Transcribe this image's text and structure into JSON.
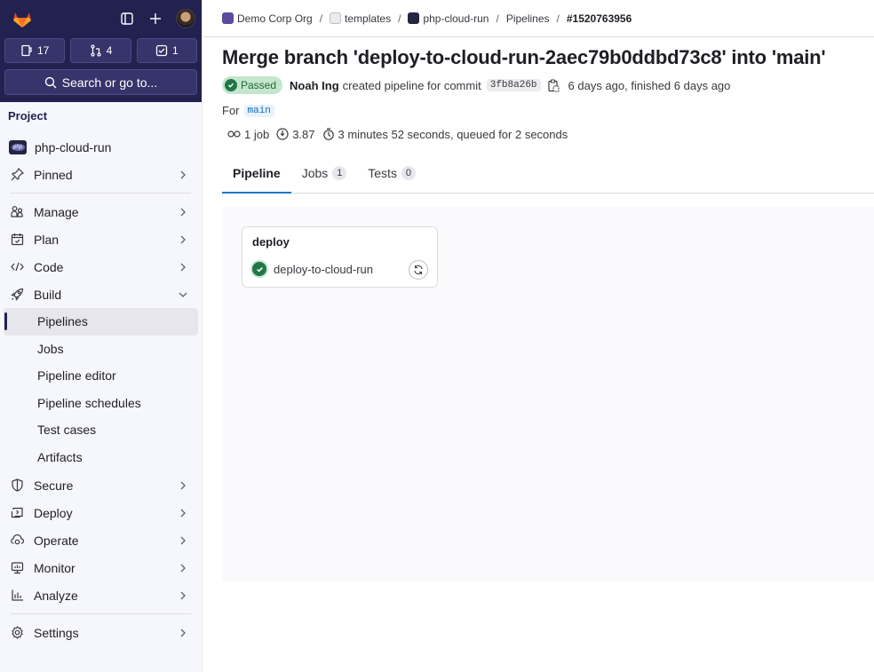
{
  "sidebar": {
    "counts": [
      {
        "icon": "issues-icon",
        "value": "17"
      },
      {
        "icon": "merge-request-icon",
        "value": "4"
      },
      {
        "icon": "todo-icon",
        "value": "1"
      }
    ],
    "search_label": "Search or go to...",
    "section_heading": "Project",
    "project_name": "php-cloud-run",
    "project_avatar_text": "php",
    "pinned_label": "Pinned",
    "items": [
      {
        "label": "Manage",
        "icon": "users-icon"
      },
      {
        "label": "Plan",
        "icon": "calendar-icon"
      },
      {
        "label": "Code",
        "icon": "code-icon"
      },
      {
        "label": "Build",
        "icon": "rocket-icon",
        "expanded": true
      }
    ],
    "build_subitems": [
      {
        "label": "Pipelines",
        "active": true
      },
      {
        "label": "Jobs"
      },
      {
        "label": "Pipeline editor"
      },
      {
        "label": "Pipeline schedules"
      },
      {
        "label": "Test cases"
      },
      {
        "label": "Artifacts"
      }
    ],
    "items_after": [
      {
        "label": "Secure",
        "icon": "shield-icon"
      },
      {
        "label": "Deploy",
        "icon": "deploy-icon"
      },
      {
        "label": "Operate",
        "icon": "cloud-gear-icon"
      },
      {
        "label": "Monitor",
        "icon": "monitor-icon"
      },
      {
        "label": "Analyze",
        "icon": "chart-icon"
      }
    ],
    "settings_label": "Settings"
  },
  "breadcrumb": [
    {
      "label": "Demo Corp Org",
      "avatar_color": "#5b4a9e"
    },
    {
      "label": "templates",
      "avatar_color": "#ececef"
    },
    {
      "label": "php-cloud-run",
      "avatar_color": "#252542"
    },
    {
      "label": "Pipelines"
    },
    {
      "label": "#1520763956",
      "current": true
    }
  ],
  "pipeline": {
    "title": "Merge branch 'deploy-to-cloud-run-2aec79b0ddbd73c8' into 'main'",
    "status": "Passed",
    "author": "Noah Ing",
    "created_text": "created pipeline for commit",
    "commit_sha": "3fb8a26b",
    "time_text": "6 days ago, finished 6 days ago",
    "for_label": "For",
    "ref": "main",
    "jobs_count_text": "1 job",
    "compute_minutes": "3.87",
    "duration_text": "3 minutes 52 seconds, queued for 2 seconds"
  },
  "tabs": [
    {
      "label": "Pipeline",
      "active": true
    },
    {
      "label": "Jobs",
      "count": "1"
    },
    {
      "label": "Tests",
      "count": "0"
    }
  ],
  "graph": {
    "stages": [
      {
        "name": "deploy",
        "jobs": [
          {
            "name": "deploy-to-cloud-run",
            "status": "success"
          }
        ]
      }
    ]
  },
  "colors": {
    "sidebar_top": "#232150",
    "success": "#217645",
    "success_bg": "#c3e6cd",
    "tab_active": "#1f75cb",
    "ref_text": "#1068bf"
  }
}
